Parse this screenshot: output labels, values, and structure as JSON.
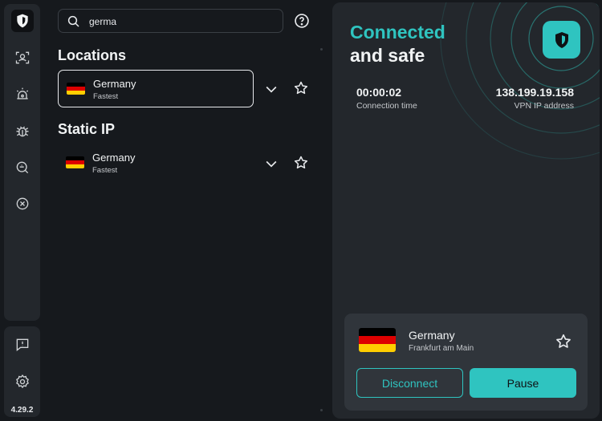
{
  "app": {
    "version": "4.29.2",
    "accent_color": "#2fc4c0"
  },
  "sidebar": {
    "top_items": [
      {
        "icon": "shield-icon",
        "active": true
      },
      {
        "icon": "user-scan-icon"
      },
      {
        "icon": "alarm-icon"
      },
      {
        "icon": "bug-icon"
      },
      {
        "icon": "search-scan-icon"
      },
      {
        "icon": "blocked-icon"
      }
    ],
    "bottom_items": [
      {
        "icon": "feedback-icon"
      },
      {
        "icon": "gear-icon"
      }
    ]
  },
  "search": {
    "value": "germa",
    "placeholder": "Search"
  },
  "locations": {
    "title": "Locations",
    "items": [
      {
        "name": "Germany",
        "sub": "Fastest",
        "selected": true
      }
    ]
  },
  "static_ip": {
    "title": "Static IP",
    "items": [
      {
        "name": "Germany",
        "sub": "Fastest"
      }
    ]
  },
  "status": {
    "line1": "Connected",
    "line2": "and safe",
    "connection_time": "00:00:02",
    "connection_time_label": "Connection time",
    "ip": "138.199.19.158",
    "ip_label": "VPN IP address"
  },
  "connection": {
    "country": "Germany",
    "city": "Frankfurt am Main",
    "disconnect_label": "Disconnect",
    "pause_label": "Pause"
  }
}
